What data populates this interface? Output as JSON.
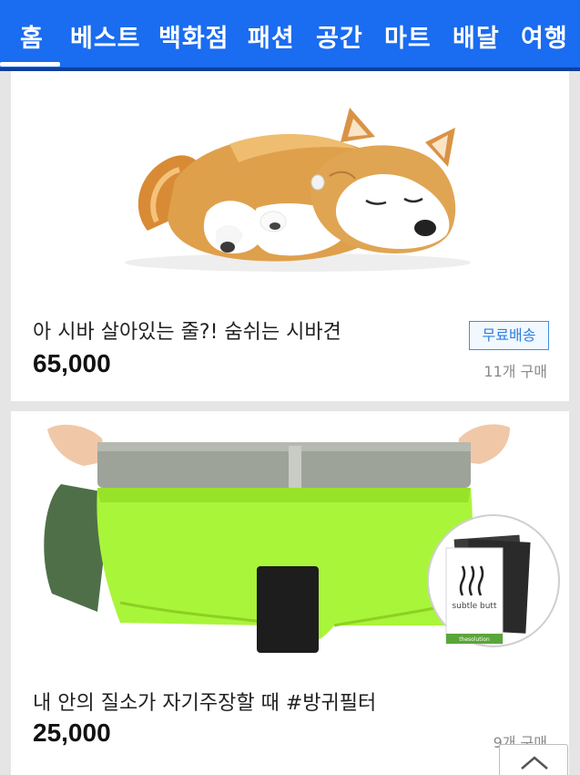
{
  "nav": {
    "tabs": [
      {
        "label": "홈"
      },
      {
        "label": "베스트"
      },
      {
        "label": "백화점"
      },
      {
        "label": "패션"
      },
      {
        "label": "공간"
      },
      {
        "label": "마트"
      },
      {
        "label": "배달"
      },
      {
        "label": "여행"
      }
    ],
    "active_index": 0
  },
  "products": [
    {
      "title": "아 시바 살아있는 줄?! 숨쉬는 시바견",
      "price": "65,000",
      "badge": "무료배송",
      "buy_count": "11개 구매",
      "image": "sleeping-shiba-plush"
    },
    {
      "title": "내 안의 질소가 자기주장할 때 #방귀필터",
      "price": "25,000",
      "buy_count": "9개 구매",
      "image": "green-boxer-with-fart-filter",
      "inset_text": {
        "brand": "subtle butt",
        "maker": "thesolution"
      }
    }
  ],
  "colors": {
    "nav_bg": "#1a6cf0",
    "badge": "#2c7fe0"
  },
  "icons": {
    "scroll_top": "chevron-up-icon"
  }
}
